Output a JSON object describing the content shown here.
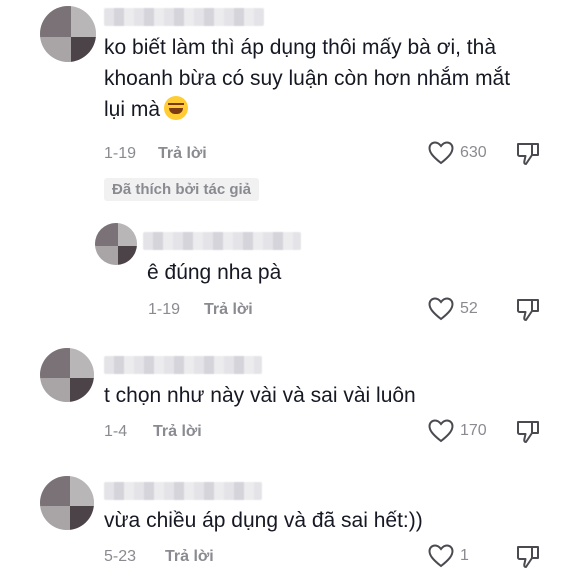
{
  "comments": [
    {
      "text": "ko biết làm thì áp dụng thôi mấy bà ơi, thà\nkhoanh bừa có suy luận còn hơn nhắm mắt\nlụi mà",
      "emoji": "laughing-tears",
      "date": "1-19",
      "reply_label": "Trả lời",
      "likes": "630",
      "liked_by_author": "Đã thích bởi tác giả",
      "replies": [
        {
          "text": "ê đúng nha pà",
          "date": "1-19",
          "reply_label": "Trả lời",
          "likes": "52"
        }
      ]
    },
    {
      "text": "t chọn như này vài và sai vài luôn",
      "date": "1-4",
      "reply_label": "Trả lời",
      "likes": "170"
    },
    {
      "text": "vừa chiều áp dụng và đã sai hết:))",
      "date": "5-23",
      "reply_label": "Trả lời",
      "likes": "1"
    }
  ],
  "icons": {
    "like": "heart-outline-icon",
    "dislike": "thumbs-down-icon"
  }
}
